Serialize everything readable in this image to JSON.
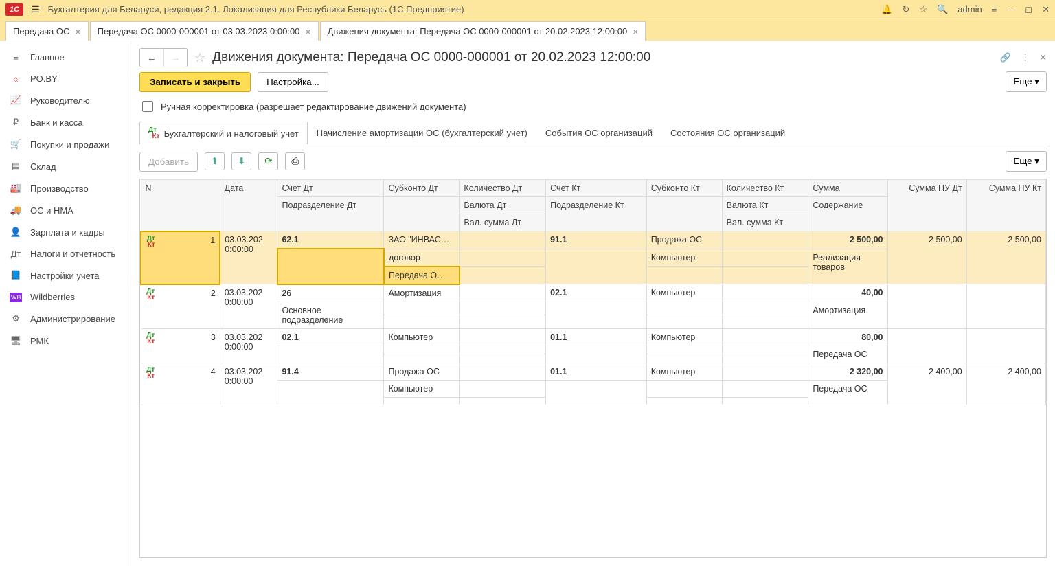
{
  "titlebar": {
    "app_title": "Бухгалтерия для Беларуси, редакция 2.1. Локализация для Республики Беларусь   (1С:Предприятие)",
    "user": "admin"
  },
  "tabs": [
    {
      "label": "Передача ОС"
    },
    {
      "label": "Передача ОС 0000-000001 от 03.03.2023 0:00:00"
    },
    {
      "label": "Движения документа: Передача ОС 0000-000001 от 20.02.2023 12:00:00"
    }
  ],
  "sidebar": {
    "items": [
      {
        "icon": "≡",
        "label": "Главное"
      },
      {
        "icon": "☼",
        "label": "PO.BY"
      },
      {
        "icon": "📈",
        "label": "Руководителю"
      },
      {
        "icon": "₽",
        "label": "Банк и касса"
      },
      {
        "icon": "🛒",
        "label": "Покупки и продажи"
      },
      {
        "icon": "▤",
        "label": "Склад"
      },
      {
        "icon": "🏭",
        "label": "Производство"
      },
      {
        "icon": "🚚",
        "label": "ОС и НМА"
      },
      {
        "icon": "👤",
        "label": "Зарплата и кадры"
      },
      {
        "icon": "Дт",
        "label": "Налоги и отчетность"
      },
      {
        "icon": "📘",
        "label": "Настройки учета"
      },
      {
        "icon": "WB",
        "label": "Wildberries"
      },
      {
        "icon": "⚙",
        "label": "Администрирование"
      },
      {
        "icon": "🖥",
        "label": "РМК"
      }
    ]
  },
  "doc": {
    "title": "Движения документа: Передача ОС 0000-000001 от 20.02.2023 12:00:00",
    "btn_save": "Записать и закрыть",
    "btn_settings": "Настройка...",
    "chk_manual": "Ручная корректировка (разрешает редактирование движений документа)",
    "btn_more": "Еще"
  },
  "inner_tabs": [
    {
      "label": "Бухгалтерский и налоговый учет",
      "hasIcon": true
    },
    {
      "label": "Начисление амортизации ОС (бухгалтерский учет)"
    },
    {
      "label": "События ОС организаций"
    },
    {
      "label": "Состояния ОС организаций"
    }
  ],
  "tbl_toolbar": {
    "btn_add": "Добавить",
    "btn_more": "Еще"
  },
  "headers": {
    "n": "N",
    "date": "Дата",
    "acct_dt": "Счет Дт",
    "dept_dt": "Подразделение Дт",
    "subk_dt": "Субконто Дт",
    "qty_dt": "Количество Дт",
    "cur_dt": "Валюта Дт",
    "valsum_dt": "Вал. сумма Дт",
    "acct_kt": "Счет Кт",
    "dept_kt": "Подразделение Кт",
    "subk_kt": "Субконто Кт",
    "qty_kt": "Количество Кт",
    "cur_kt": "Валюта Кт",
    "valsum_kt": "Вал. сумма Кт",
    "sum": "Сумма",
    "content": "Содержание",
    "nu_dt": "Сумма НУ Дт",
    "nu_kt": "Сумма НУ Кт"
  },
  "rows": [
    {
      "n": "1",
      "date": "03.03.202 0:00:00",
      "acct_dt": "62.1",
      "subk_dt1": "ЗАО \"ИНВАС…",
      "subk_dt2": "договор",
      "subk_dt3": "Передача О…",
      "acct_kt": "91.1",
      "subk_kt1": "Продажа ОС",
      "subk_kt2": "Компьютер",
      "sum": "2 500,00",
      "content": "Реализация товаров",
      "nu_dt": "2 500,00",
      "nu_kt": "2 500,00"
    },
    {
      "n": "2",
      "date": "03.03.202 0:00:00",
      "acct_dt": "26",
      "dept_dt": "Основное подразделение",
      "subk_dt1": "Амортизация",
      "acct_kt": "02.1",
      "subk_kt1": "Компьютер",
      "sum": "40,00",
      "content": "Амортизация"
    },
    {
      "n": "3",
      "date": "03.03.202 0:00:00",
      "acct_dt": "02.1",
      "subk_dt1": "Компьютер",
      "acct_kt": "01.1",
      "subk_kt1": "Компьютер",
      "sum": "80,00",
      "content": "Передача ОС"
    },
    {
      "n": "4",
      "date": "03.03.202 0:00:00",
      "acct_dt": "91.4",
      "subk_dt1": "Продажа ОС",
      "subk_dt2": "Компьютер",
      "acct_kt": "01.1",
      "subk_kt1": "Компьютер",
      "sum": "2 320,00",
      "content": "Передача ОС",
      "nu_dt": "2 400,00",
      "nu_kt": "2 400,00"
    }
  ]
}
